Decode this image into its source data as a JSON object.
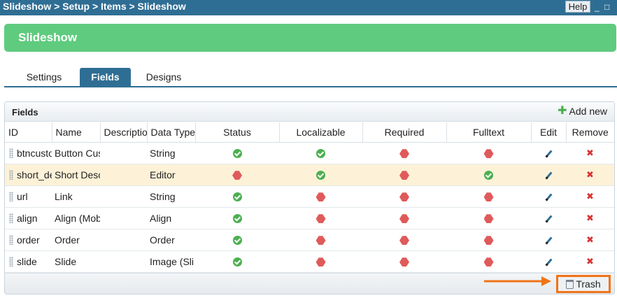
{
  "breadcrumb": "Slideshow > Setup > Items > Slideshow",
  "help_label": "Help",
  "window_controls": {
    "minimize": "_",
    "maximize": "□"
  },
  "page_title": "Slideshow",
  "tabs": [
    {
      "label": "Settings",
      "active": false
    },
    {
      "label": "Fields",
      "active": true
    },
    {
      "label": "Designs",
      "active": false
    }
  ],
  "panel": {
    "title": "Fields",
    "add_new_label": "Add new",
    "columns": [
      "ID",
      "Name",
      "Descriptio",
      "Data Type",
      "Status",
      "Localizable",
      "Required",
      "Fulltext",
      "Edit",
      "Remove"
    ],
    "rows": [
      {
        "id": "btncusto",
        "name": "Button Cus",
        "description": "",
        "data_type": "String",
        "status": "ok",
        "localizable": "ok",
        "required": "no",
        "fulltext": "no",
        "highlighted": false
      },
      {
        "id": "short_de",
        "name": "Short Desc",
        "description": "",
        "data_type": "Editor",
        "status": "no",
        "localizable": "ok",
        "required": "no",
        "fulltext": "ok",
        "highlighted": true
      },
      {
        "id": "url",
        "name": "Link",
        "description": "",
        "data_type": "String",
        "status": "ok",
        "localizable": "no",
        "required": "no",
        "fulltext": "no",
        "highlighted": false
      },
      {
        "id": "align",
        "name": "Align (Mob",
        "description": "",
        "data_type": "Align",
        "status": "ok",
        "localizable": "no",
        "required": "no",
        "fulltext": "no",
        "highlighted": false
      },
      {
        "id": "order",
        "name": "Order",
        "description": "",
        "data_type": "Order",
        "status": "ok",
        "localizable": "no",
        "required": "no",
        "fulltext": "no",
        "highlighted": false
      },
      {
        "id": "slide",
        "name": "Slide",
        "description": "",
        "data_type": "Image (Sli",
        "status": "ok",
        "localizable": "no",
        "required": "no",
        "fulltext": "no",
        "highlighted": false
      }
    ],
    "trash_label": "Trash"
  },
  "colors": {
    "accent": "#2f6e94",
    "title_green": "#5fcb7e",
    "highlight_row": "#fdf2d8",
    "callout_orange": "#f07418",
    "ok_green": "#4caf50",
    "no_red": "#e05a5a"
  },
  "icons": {
    "ok": "check-circle-icon",
    "no": "red-hexagon-icon",
    "edit": "pencil-icon",
    "remove": "red-x-icon",
    "trash": "trash-icon",
    "add": "plus-icon"
  }
}
